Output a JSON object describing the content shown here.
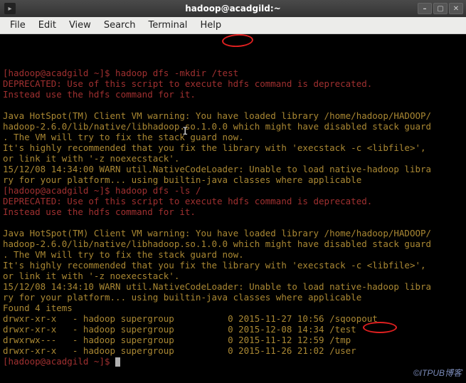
{
  "titlebar": {
    "title": "hadoop@acadgild:~"
  },
  "menubar": {
    "items": [
      "File",
      "Edit",
      "View",
      "Search",
      "Terminal",
      "Help"
    ]
  },
  "terminal": {
    "prompt": "[hadoop@acadgild ~]$ ",
    "lines": [
      {
        "type": "cmd",
        "prompt": "[hadoop@acadgild ~]$ ",
        "text": "hadoop dfs -mkdir /test"
      },
      {
        "type": "dep",
        "text": "DEPRECATED: Use of this script to execute hdfs command is deprecated."
      },
      {
        "type": "dep",
        "text": "Instead use the hdfs command for it."
      },
      {
        "type": "blank",
        "text": ""
      },
      {
        "type": "msg",
        "text": "Java HotSpot(TM) Client VM warning: You have loaded library /home/hadoop/HADOOP/"
      },
      {
        "type": "msg",
        "text": "hadoop-2.6.0/lib/native/libhadoop.so.1.0.0 which might have disabled stack guard"
      },
      {
        "type": "msg",
        "text": ". The VM will try to fix the stack guard now."
      },
      {
        "type": "msg",
        "text": "It's highly recommended that you fix the library with 'execstack -c <libfile>',"
      },
      {
        "type": "msg",
        "text": "or link it with '-z noexecstack'."
      },
      {
        "type": "msg",
        "text": "15/12/08 14:34:00 WARN util.NativeCodeLoader: Unable to load native-hadoop libra"
      },
      {
        "type": "msg",
        "text": "ry for your platform... using builtin-java classes where applicable"
      },
      {
        "type": "cmd",
        "prompt": "[hadoop@acadgild ~]$ ",
        "text": "hadoop dfs -ls /"
      },
      {
        "type": "dep",
        "text": "DEPRECATED: Use of this script to execute hdfs command is deprecated."
      },
      {
        "type": "dep",
        "text": "Instead use the hdfs command for it."
      },
      {
        "type": "blank",
        "text": ""
      },
      {
        "type": "msg",
        "text": "Java HotSpot(TM) Client VM warning: You have loaded library /home/hadoop/HADOOP/"
      },
      {
        "type": "msg",
        "text": "hadoop-2.6.0/lib/native/libhadoop.so.1.0.0 which might have disabled stack guard"
      },
      {
        "type": "msg",
        "text": ". The VM will try to fix the stack guard now."
      },
      {
        "type": "msg",
        "text": "It's highly recommended that you fix the library with 'execstack -c <libfile>',"
      },
      {
        "type": "msg",
        "text": "or link it with '-z noexecstack'."
      },
      {
        "type": "msg",
        "text": "15/12/08 14:34:10 WARN util.NativeCodeLoader: Unable to load native-hadoop libra"
      },
      {
        "type": "msg",
        "text": "ry for your platform... using builtin-java classes where applicable"
      },
      {
        "type": "ls",
        "text": "Found 4 items"
      },
      {
        "type": "ls",
        "text": "drwxr-xr-x   - hadoop supergroup          0 2015-11-27 10:56 /sqoopout"
      },
      {
        "type": "ls",
        "text": "drwxr-xr-x   - hadoop supergroup          0 2015-12-08 14:34 /test"
      },
      {
        "type": "ls",
        "text": "drwxrwx---   - hadoop supergroup          0 2015-11-12 12:59 /tmp"
      },
      {
        "type": "ls",
        "text": "drwxr-xr-x   - hadoop supergroup          0 2015-11-26 21:02 /user"
      },
      {
        "type": "cmd",
        "prompt": "[hadoop@acadgild ~]$ ",
        "text": "",
        "cursor": true
      }
    ]
  },
  "watermark": "©ITPUB博客"
}
